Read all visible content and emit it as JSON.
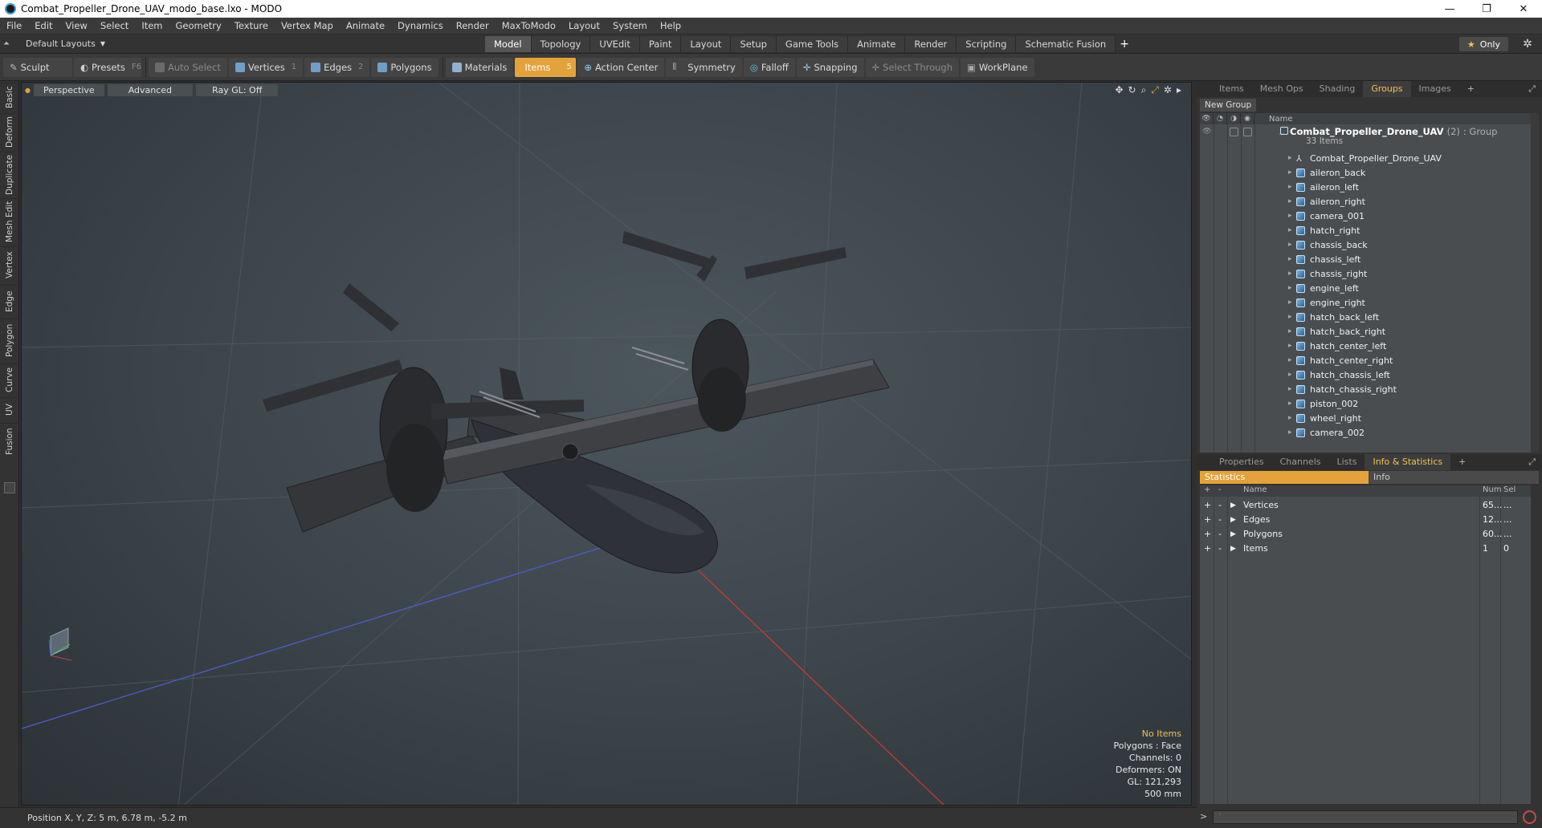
{
  "window": {
    "title": "Combat_Propeller_Drone_UAV_modo_base.lxo - MODO",
    "controls": [
      "—",
      "❐",
      "✕"
    ]
  },
  "menu": [
    "File",
    "Edit",
    "View",
    "Select",
    "Item",
    "Geometry",
    "Texture",
    "Vertex Map",
    "Animate",
    "Dynamics",
    "Render",
    "MaxToModo",
    "Layout",
    "System",
    "Help"
  ],
  "layout_menu": "Default Layouts",
  "layout_tabs": [
    "Model",
    "Topology",
    "UVEdit",
    "Paint",
    "Layout",
    "Setup",
    "Game Tools",
    "Animate",
    "Render",
    "Scripting",
    "Schematic Fusion"
  ],
  "layout_active": "Model",
  "only_label": "Only",
  "toolbar": {
    "sculpt": "Sculpt",
    "presets": "Presets",
    "presets_key": "F6",
    "auto_select": "Auto Select",
    "vertices": "Vertices",
    "vertices_num": "1",
    "edges": "Edges",
    "edges_num": "2",
    "polygons": "Polygons",
    "materials": "Materials",
    "items": "Items",
    "items_num": "5",
    "action_center": "Action Center",
    "symmetry": "Symmetry",
    "falloff": "Falloff",
    "snapping": "Snapping",
    "select_through": "Select Through",
    "workplane": "WorkPlane"
  },
  "left_tabs": [
    "Basic",
    "Deform",
    "Duplicate",
    "Mesh Edit",
    "Vertex",
    "Edge",
    "Polygon",
    "Curve",
    "UV",
    "Fusion"
  ],
  "viewport": {
    "buttons": [
      "Perspective",
      "Advanced",
      "Ray GL: Off"
    ],
    "info": {
      "no_items": "No Items",
      "polygons": "Polygons : Face",
      "channels": "Channels: 0",
      "deformers": "Deformers: ON",
      "gl": "GL: 121,293",
      "scale": "500 mm"
    }
  },
  "status": {
    "position": "Position X, Y, Z:  5 m, 6.78 m, -5.2 m"
  },
  "groups_panel": {
    "tabs": [
      "Items",
      "Mesh Ops",
      "Shading",
      "Groups",
      "Images"
    ],
    "active": "Groups",
    "new_group": "New Group",
    "column_name": "Name",
    "root_name": "Combat_Propeller_Drone_UAV",
    "root_count": "(2)",
    "root_type": ": Group",
    "root_sub": "33 Items",
    "items": [
      "Combat_Propeller_Drone_UAV",
      "aileron_back",
      "aileron_left",
      "aileron_right",
      "camera_001",
      "hatch_right",
      "chassis_back",
      "chassis_left",
      "chassis_right",
      "engine_left",
      "engine_right",
      "hatch_back_left",
      "hatch_back_right",
      "hatch_center_left",
      "hatch_center_right",
      "hatch_chassis_left",
      "hatch_chassis_right",
      "piston_002",
      "wheel_right",
      "camera_002"
    ]
  },
  "info_panel": {
    "tabs": [
      "Properties",
      "Channels",
      "Lists",
      "Info & Statistics"
    ],
    "active": "Info & Statistics",
    "subtabs": [
      "Statistics",
      "Info"
    ],
    "columns": [
      "Name",
      "Num",
      "Sel"
    ],
    "rows": [
      {
        "name": "Vertices",
        "num": "65...",
        "sel": "..."
      },
      {
        "name": "Edges",
        "num": "12...",
        "sel": "..."
      },
      {
        "name": "Polygons",
        "num": "60...",
        "sel": "..."
      },
      {
        "name": "Items",
        "num": "1",
        "sel": "0"
      }
    ]
  },
  "command": {
    "prompt": ">",
    "placeholder": "`"
  },
  "colors": {
    "accent": "#e3a23a",
    "highlight": "#f2c24f",
    "viewport_bg": "#3b444a",
    "panel": "#4a4d50"
  },
  "icons": {
    "sculpt": "brush-icon",
    "presets": "presets-icon",
    "settings": "gear-icon",
    "star": "star-icon"
  }
}
